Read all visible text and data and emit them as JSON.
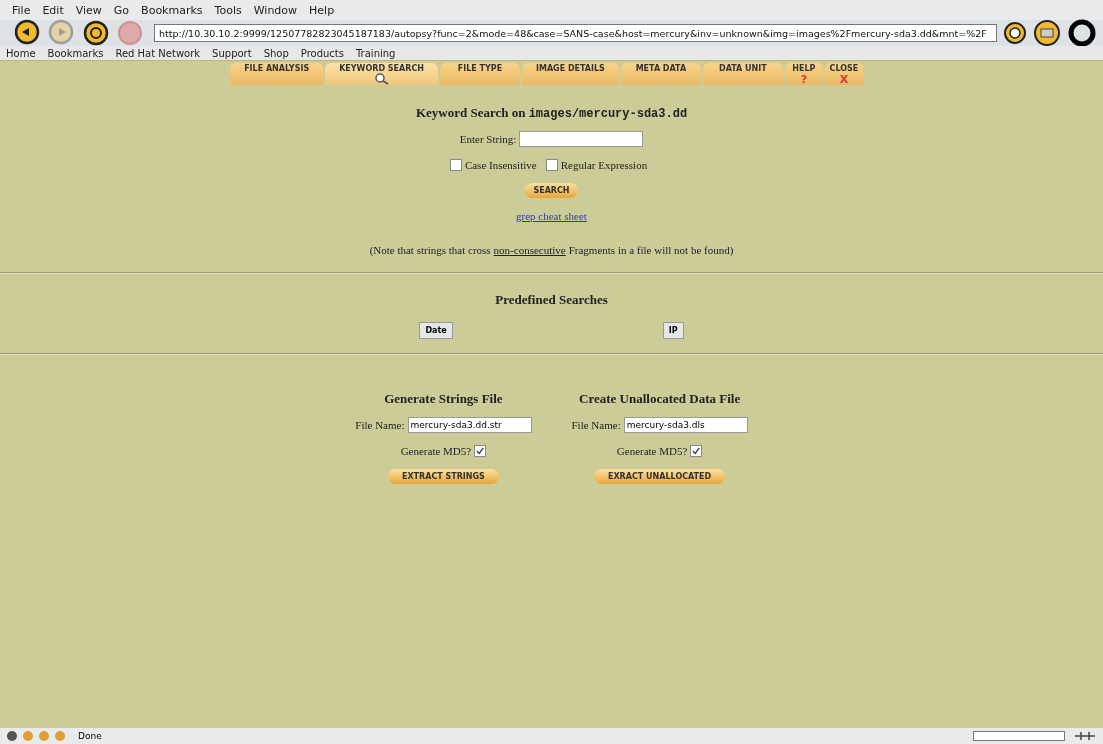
{
  "menu_bar": [
    "File",
    "Edit",
    "View",
    "Go",
    "Bookmarks",
    "Tools",
    "Window",
    "Help"
  ],
  "toolbar": {
    "address": "http://10.30.10.2:9999/12507782823045187183/autopsy?func=2&mode=48&case=SANS-case&host=mercury&inv=unknown&img=images%2Fmercury-sda3.dd&mnt=%2F",
    "back_disabled": false,
    "forward_disabled": true,
    "stop_disabled": true
  },
  "bookmarks": [
    "Home",
    "Bookmarks",
    "Red Hat Network",
    "Support",
    "Shop",
    "Products",
    "Training"
  ],
  "tabs": [
    {
      "label": "FILE ANALYSIS",
      "selected": false
    },
    {
      "label": "KEYWORD SEARCH",
      "selected": true
    },
    {
      "label": "FILE TYPE",
      "selected": false
    },
    {
      "label": "IMAGE DETAILS",
      "selected": false
    },
    {
      "label": "META DATA",
      "selected": false
    },
    {
      "label": "DATA UNIT",
      "selected": false
    },
    {
      "label": "HELP",
      "selected": false,
      "glyph": "?"
    },
    {
      "label": "CLOSE",
      "selected": false,
      "glyph": "X"
    }
  ],
  "keyword_search": {
    "title": "Keyword Search on ",
    "title_path": "images/mercury-sda3.dd",
    "field_label": "Enter String:",
    "options": [
      {
        "label": "Case Insensitive",
        "checked": false
      },
      {
        "label": "Regular Expression",
        "checked": false
      }
    ],
    "button": "SEARCH",
    "link": "grep cheat sheet",
    "note_before": "(Note that strings that cross ",
    "note_link": "non-consecutive",
    "note_after": " Fragments in a file will not be found)"
  },
  "predefined": {
    "title": "Predefined Searches",
    "buttons": [
      "Date",
      "IP"
    ]
  },
  "files": [
    {
      "title": "Generate Strings File",
      "field_label": "File Name:",
      "value": "mercury-sda3.dd.str",
      "md5_label": "Generate MD5?",
      "md5": true,
      "button": "EXTRACT STRINGS"
    },
    {
      "title": "Create Unallocated Data File",
      "field_label": "File Name:",
      "value": "mercury-sda3.dls",
      "md5_label": "Generate MD5?",
      "md5": true,
      "button": "EXRACT UNALLOCATED"
    }
  ],
  "status_bar": {
    "text": "Done"
  }
}
